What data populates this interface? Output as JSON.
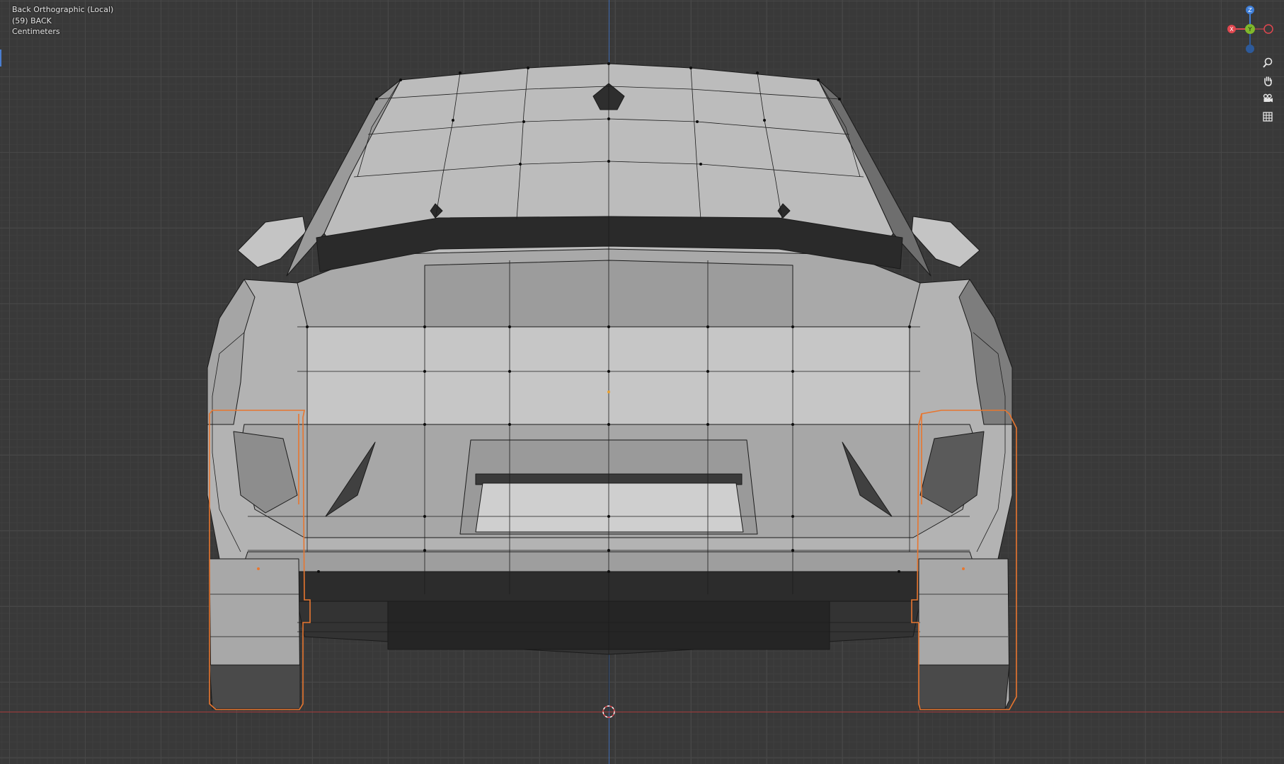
{
  "viewport": {
    "view_name": "Back Orthographic (Local)",
    "object_info": "(59) BACK",
    "units": "Centimeters"
  },
  "gizmo": {
    "z_label": "Z",
    "y_label": "Y",
    "x_label": "X",
    "colors": {
      "x": "#e0474f",
      "y": "#7fb82b",
      "z": "#3f7fd9"
    }
  },
  "nav_tools": [
    {
      "name": "zoom",
      "icon": "magnifier-icon"
    },
    {
      "name": "pan",
      "icon": "hand-icon"
    },
    {
      "name": "camera",
      "icon": "camera-icon"
    },
    {
      "name": "grid-view",
      "icon": "grid-icon"
    }
  ],
  "colors": {
    "background": "#393939",
    "selection_outline": "#e8762f",
    "body_light": "#b9b9b9",
    "body_dark": "#2b2b2b"
  }
}
